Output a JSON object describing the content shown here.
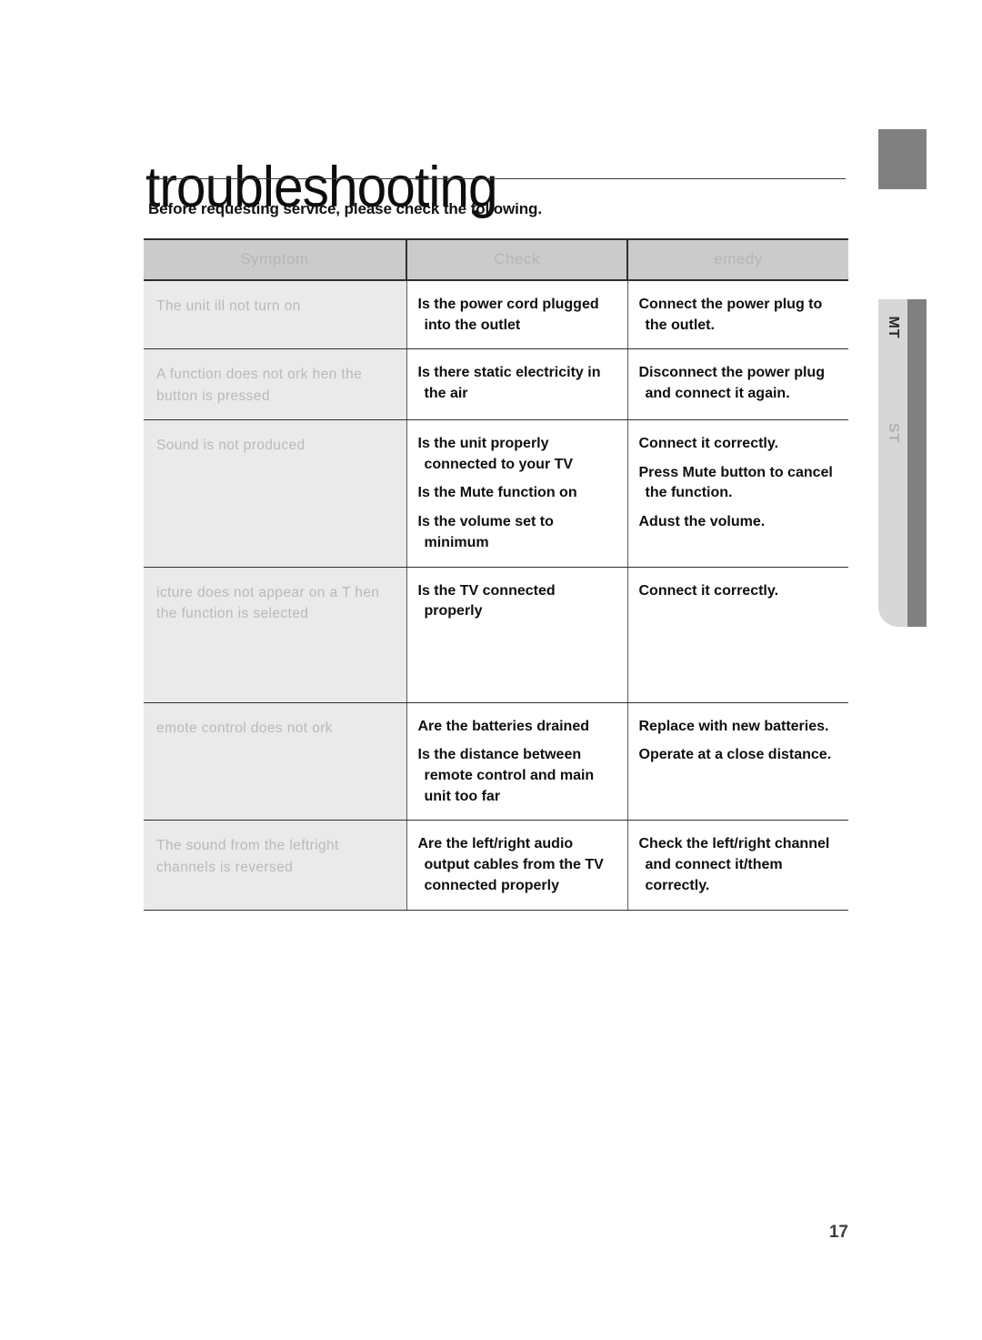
{
  "document": {
    "title": "troubleshooting",
    "subtitle": "Before requesting service, please check the following.",
    "page_number": "17"
  },
  "side_tab": {
    "label_top": "MT",
    "label_bottom": "ST"
  },
  "table": {
    "headers": {
      "symptom": "Symptom",
      "check": "Check",
      "remedy": "emedy"
    },
    "rows": [
      {
        "symptom": "The unit  ill   not turn  on",
        "check": [
          {
            "line1": "Is the power cord plugged",
            "line2": "into the outlet"
          }
        ],
        "remedy": [
          {
            "line1": "Connect the power plug to",
            "line2": "the outlet."
          }
        ]
      },
      {
        "symptom": "A function   does not  ork    hen the  button  is pressed",
        "check": [
          {
            "line1": "Is there static electricity in",
            "line2": "the air"
          }
        ],
        "remedy": [
          {
            "line1": "Disconnect the power plug",
            "line2": "and connect it again."
          }
        ]
      },
      {
        "symptom": "Sound  is not produced",
        "check": [
          {
            "line1": "Is the unit properly",
            "line2": "connected to your TV"
          },
          {
            "line1": "Is the Mute function on",
            "line2": ""
          },
          {
            "line1": "Is the volume set to",
            "line2": "minimum"
          }
        ],
        "remedy": [
          {
            "line1": "Connect it correctly.",
            "line2": ""
          },
          {
            "line1": "Press Mute button to cancel",
            "line2": "the function."
          },
          {
            "line1": "Adust the volume.",
            "line2": ""
          }
        ]
      },
      {
        "symptom": "icture    does not appear  on a T   hen    the function  is selected",
        "check": [
          {
            "line1": "Is the TV connected",
            "line2": "properly"
          }
        ],
        "remedy": [
          {
            "line1": "Connect it correctly.",
            "line2": ""
          }
        ]
      },
      {
        "symptom": "emote    control  does not  ork",
        "check": [
          {
            "line1": "Are the batteries drained",
            "line2": ""
          },
          {
            "line1": "Is the distance between",
            "line2": "remote control and main unit too far"
          }
        ],
        "remedy": [
          {
            "line1": "Replace with new batteries.",
            "line2": ""
          },
          {
            "line1": "Operate at a close distance.",
            "line2": ""
          }
        ]
      },
      {
        "symptom": "The sound  from  the leftright channels   is reversed",
        "check": [
          {
            "line1": "Are the left/right audio",
            "line2": "output cables from the TV connected properly"
          }
        ],
        "remedy": [
          {
            "line1": "Check the  left/right channel",
            "line2": "and connect it/them correctly."
          }
        ]
      }
    ]
  }
}
